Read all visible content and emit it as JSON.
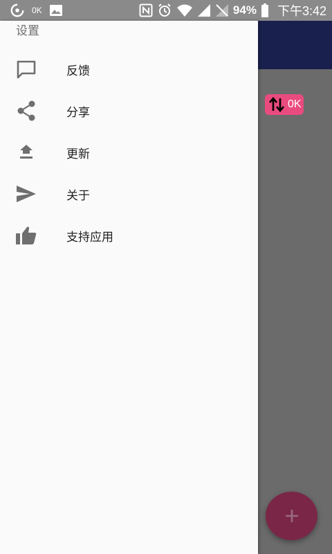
{
  "status_bar": {
    "data_speed": "0K",
    "battery": "94%",
    "time": "下午3:42"
  },
  "drawer": {
    "header": "设置",
    "items": [
      {
        "label": "反馈",
        "icon": "message-icon"
      },
      {
        "label": "分享",
        "icon": "share-icon"
      },
      {
        "label": "更新",
        "icon": "upload-icon"
      },
      {
        "label": "关于",
        "icon": "send-icon"
      },
      {
        "label": "支持应用",
        "icon": "thumb-up-icon"
      }
    ]
  },
  "background_app": {
    "speed_badge": "0K",
    "fab_label": "+"
  },
  "colors": {
    "toolbar": "#19204d",
    "badge": "#e94b7f",
    "fab": "#7a2647",
    "drawer_bg": "#fafafa"
  }
}
